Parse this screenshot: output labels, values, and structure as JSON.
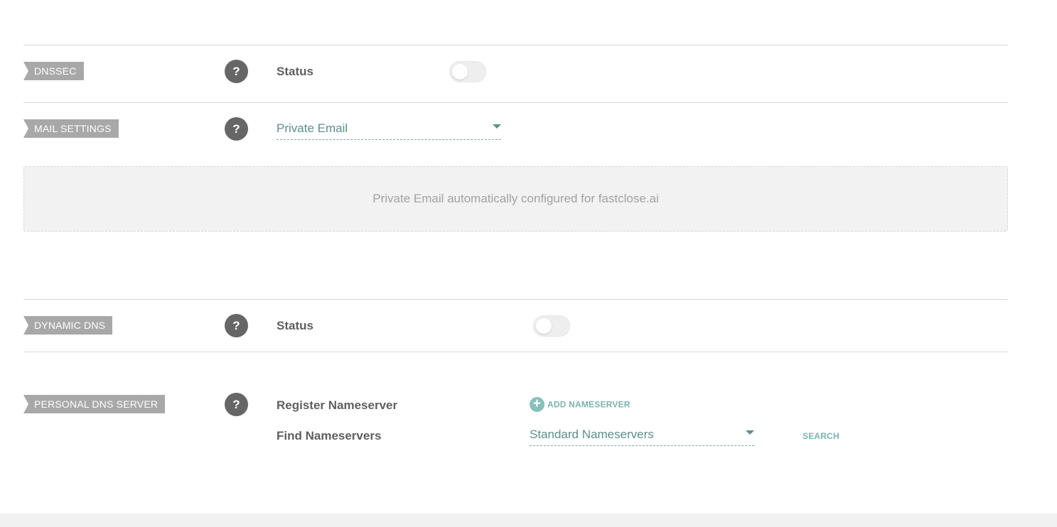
{
  "dnssec": {
    "tag": "DNSSEC",
    "help": "?",
    "status_label": "Status",
    "status_on": false
  },
  "mail_settings": {
    "tag": "MAIL SETTINGS",
    "help": "?",
    "selected": "Private Email",
    "info": "Private Email automatically configured for fastclose.ai"
  },
  "dynamic_dns": {
    "tag": "DYNAMIC DNS",
    "help": "?",
    "status_label": "Status",
    "status_on": false
  },
  "personal_dns": {
    "tag": "PERSONAL DNS SERVER",
    "help": "?",
    "register_label": "Register Nameserver",
    "add_label": "ADD NAMESERVER",
    "find_label": "Find Nameservers",
    "find_selected": "Standard Nameservers",
    "search_label": "SEARCH"
  },
  "colors": {
    "accent": "#79b4b0",
    "tag_bg": "#a8a8a8",
    "help_bg": "#666666"
  }
}
